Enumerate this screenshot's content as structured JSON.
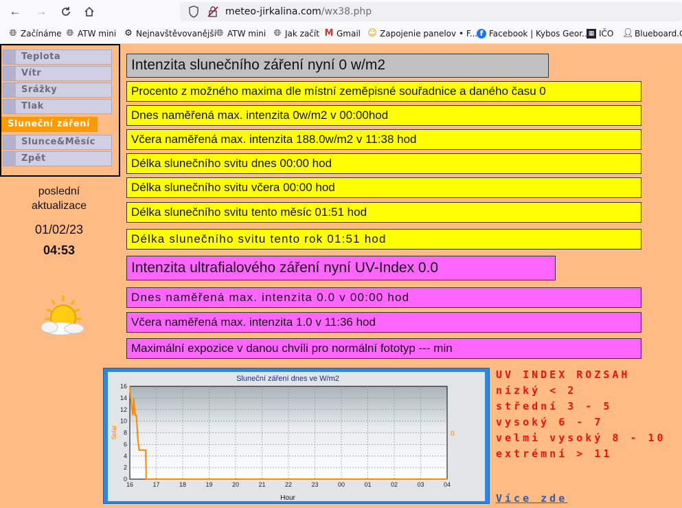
{
  "browser": {
    "url_host": "meteo-jirkalina.com",
    "url_path": "/wx38.php",
    "bookmarks": [
      {
        "icon": "globe-icon",
        "label": "Začínáme"
      },
      {
        "icon": "globe-icon",
        "label": "ATW mini"
      },
      {
        "icon": "gear-icon",
        "label": "Nejnavštěvovanější"
      },
      {
        "icon": "globe-icon",
        "label": "ATW mini"
      },
      {
        "icon": "globe-icon",
        "label": "Jak začít"
      },
      {
        "icon": "gmail-icon",
        "label": "Gmail"
      },
      {
        "icon": "smiley-icon",
        "label": "Zapojenie panelov • F..."
      },
      {
        "icon": "facebook-icon",
        "label": "Facebook | Kybos Geor..."
      },
      {
        "icon": "ico-icon",
        "label": "IČO"
      },
      {
        "icon": "user-icon",
        "label": "Blueboard.CZ"
      }
    ]
  },
  "menu": {
    "items": [
      "Teplota",
      "Vítr",
      "Srážky",
      "Tlak",
      "Sluneční záření",
      "Slunce&Měsíc",
      "Zpět"
    ],
    "active_index": 4
  },
  "updated": {
    "label": "poslední aktualizace",
    "date": "01/02/23",
    "time": "04:53"
  },
  "solar": {
    "now": "Intenzita slunečního záření nyní 0 w/m2",
    "percent": "Procento z možného maxima dle místní zeměpisné souřadnice a daného času 0",
    "today_max": "Dnes naměřená max. intenzita 0w/m2 v 00:00hod",
    "yesterday_max": "Včera naměřená max. intenzita 188.0w/m2 v 11:38 hod",
    "sunshine_today": "Délka slunečního svitu dnes 00:00 hod",
    "sunshine_yesterday": "Délka slunečního svitu včera 00:00 hod",
    "sunshine_month": "Délka slunečního svitu tento měsíc 01:51 hod",
    "sunshine_year": "Délka slunečního svitu tento rok 01:51 hod"
  },
  "uv": {
    "now": "Intenzita ultrafialového záření nyní UV-Index 0.0",
    "today_max": "Dnes naměřená max. intenzita 0.0 v 00:00 hod",
    "yesterday_max": "Včera naměřená max. intenzita 1.0 v 11:36 hod",
    "exposure": "Maximální expozice v danou chvíli pro normální fototyp --- min"
  },
  "uv_legend": {
    "title": "UV INDEX ROZSAH",
    "lines": [
      "nízký < 2",
      "střední 3 - 5",
      "vysoký 6 - 7",
      "velmi vysoký 8 - 10",
      "extrémní > 11"
    ],
    "more": "Více zde"
  },
  "colors": {
    "page_bg": "#ffbb84",
    "row_yellow": "#ffff00",
    "row_pink": "#ff66ff",
    "row_gray": "#c0c0c0",
    "menu_active": "#ff9900",
    "legend_red": "#ee1111",
    "chart_line": "#ff8800"
  },
  "chart_data": {
    "type": "line",
    "title": "Sluneční záření dnes ve W/m2",
    "xlabel": "Hour",
    "ylabel": "Solar",
    "x_ticks": [
      "16",
      "17",
      "18",
      "19",
      "20",
      "21",
      "22",
      "23",
      "00",
      "01",
      "02",
      "03",
      "04"
    ],
    "y_ticks": [
      0,
      2,
      4,
      6,
      8,
      10,
      12,
      14,
      16
    ],
    "right_axis_label": "0",
    "ylim": [
      0,
      16
    ],
    "grid": true,
    "series": [
      {
        "x": [
          16.0,
          16.03,
          16.06,
          16.09,
          16.12,
          16.15,
          16.18,
          16.21,
          16.25,
          16.3,
          16.35,
          16.4,
          16.45,
          16.5,
          16.55,
          16.6,
          16.62,
          16.7,
          17.0,
          18.0,
          19.0,
          20.0,
          21.0,
          22.0,
          23.0,
          24.0,
          25.0,
          26.0,
          27.0,
          28.0
        ],
        "y": [
          16,
          14,
          13,
          12,
          11,
          14,
          12,
          11,
          11,
          7,
          5,
          5,
          5,
          5,
          5,
          5,
          0,
          0,
          0,
          0,
          0,
          0,
          0,
          0,
          0,
          0,
          0,
          0,
          0,
          0
        ]
      }
    ]
  }
}
